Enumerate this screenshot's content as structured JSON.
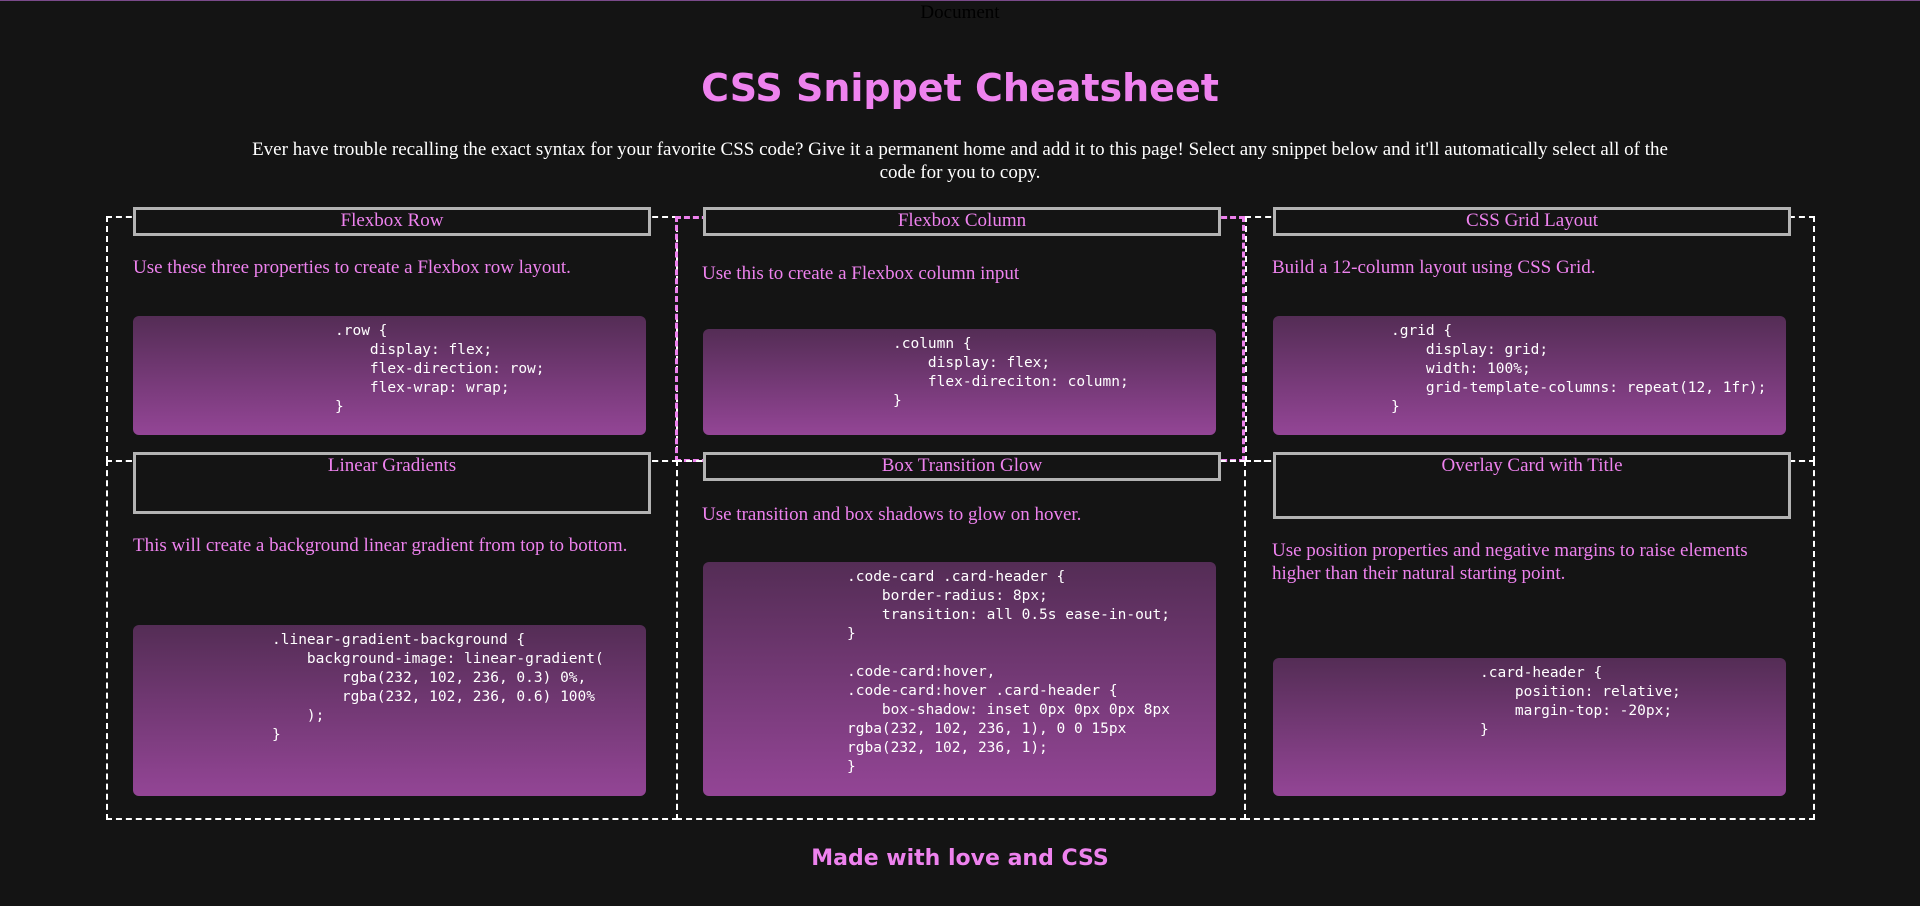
{
  "document": {
    "title": "Document"
  },
  "header": {
    "title": "CSS Snippet Cheatsheet",
    "intro": "Ever have trouble recalling the exact syntax for your favorite CSS code? Give it a permanent home and add it to this page! Select any snippet below and it'll automatically select all of the code for you to copy."
  },
  "cards": [
    {
      "title": "Flexbox Row",
      "description": "Use these three properties to create a Flexbox row layout.",
      "code": ".row {\n    display: flex;\n    flex-direction: row;\n    flex-wrap: wrap;\n}"
    },
    {
      "title": "Flexbox Column",
      "description": "Use this to create a Flexbox column input",
      "code": ".column {\n    display: flex;\n    flex-direciton: column;\n}"
    },
    {
      "title": "CSS Grid Layout",
      "description": "Build a 12-column layout using CSS Grid.",
      "code": ".grid {\n    display: grid;\n    width: 100%;\n    grid-template-columns: repeat(12, 1fr);\n}"
    },
    {
      "title": "Linear Gradients",
      "description": "This will create a background linear gradient from top to bottom.",
      "code": ".linear-gradient-background {\n    background-image: linear-gradient(\n        rgba(232, 102, 236, 0.3) 0%,\n        rgba(232, 102, 236, 0.6) 100%\n    );\n}"
    },
    {
      "title": "Box Transition Glow",
      "description": "Use transition and box shadows to glow on hover.",
      "code": ".code-card .card-header {\n    border-radius: 8px;\n    transition: all 0.5s ease-in-out;\n}\n\n.code-card:hover,\n.code-card:hover .card-header {\n    box-shadow: inset 0px 0px 0px 8px\nrgba(232, 102, 236, 1), 0 0 15px\nrgba(232, 102, 236, 1);\n}"
    },
    {
      "title": "Overlay Card with Title",
      "description": "Use position properties and negative margins to raise elements higher than their natural starting point.",
      "code": ".card-header {\n    position: relative;\n    margin-top: -20px;\n}"
    }
  ],
  "footer": {
    "text": "Made with love and CSS"
  },
  "colors": {
    "background": "#141414",
    "accent": "#ee82ee",
    "header_border": "#b3b3b3",
    "code_gradient_start": "rgba(232, 102, 236, 0.3)",
    "code_gradient_end": "rgba(232, 102, 236, 0.6)"
  }
}
